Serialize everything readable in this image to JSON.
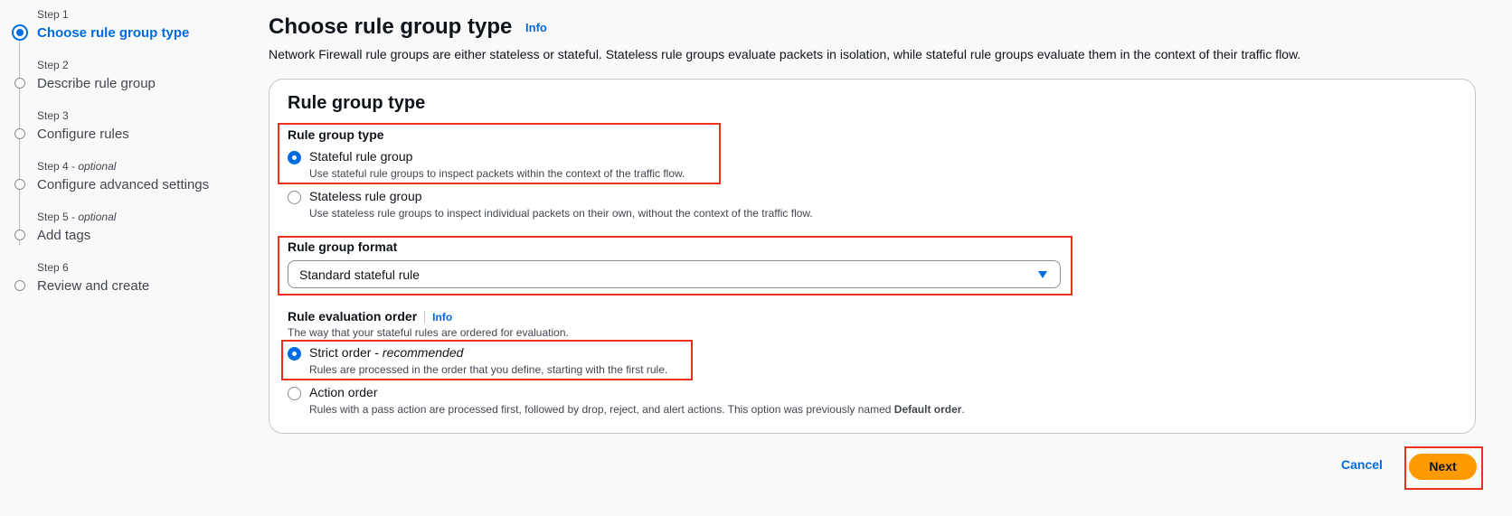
{
  "sidebar": {
    "steps": [
      {
        "number": "Step 1",
        "optional": "",
        "title": "Choose rule group type",
        "active": true
      },
      {
        "number": "Step 2",
        "optional": "",
        "title": "Describe rule group",
        "active": false
      },
      {
        "number": "Step 3",
        "optional": "",
        "title": "Configure rules",
        "active": false
      },
      {
        "number": "Step 4",
        "optional": "optional",
        "title": "Configure advanced settings",
        "active": false
      },
      {
        "number": "Step 5",
        "optional": "optional",
        "title": "Add tags",
        "active": false
      },
      {
        "number": "Step 6",
        "optional": "",
        "title": "Review and create",
        "active": false
      }
    ],
    "optional_separator": " - "
  },
  "header": {
    "title": "Choose rule group type",
    "info_label": "Info",
    "description": "Network Firewall rule groups are either stateless or stateful. Stateless rule groups evaluate packets in isolation, while stateful rule groups evaluate them in the context of their traffic flow."
  },
  "card": {
    "title": "Rule group type",
    "group_type": {
      "label": "Rule group type",
      "options": [
        {
          "label": "Stateful rule group",
          "description": "Use stateful rule groups to inspect packets within the context of the traffic flow.",
          "checked": true
        },
        {
          "label": "Stateless rule group",
          "description": "Use stateless rule groups to inspect individual packets on their own, without the context of the traffic flow.",
          "checked": false
        }
      ]
    },
    "format": {
      "label": "Rule group format",
      "selected": "Standard stateful rule"
    },
    "evaluation_order": {
      "label": "Rule evaluation order",
      "info_label": "Info",
      "description": "The way that your stateful rules are ordered for evaluation.",
      "options": [
        {
          "label": "Strict order - ",
          "label_em": "recommended",
          "description": "Rules are processed in the order that you define, starting with the first rule.",
          "checked": true
        },
        {
          "label": "Action order",
          "description": "Rules with a pass action are processed first, followed by drop, reject, and alert actions. This option was previously named ",
          "description_bold": "Default order",
          "description_end": ".",
          "checked": false
        }
      ]
    }
  },
  "footer": {
    "cancel_label": "Cancel",
    "next_label": "Next"
  },
  "colors": {
    "accent": "#006ce0",
    "primary_button": "#ff9900",
    "highlight": "#e8321e"
  }
}
